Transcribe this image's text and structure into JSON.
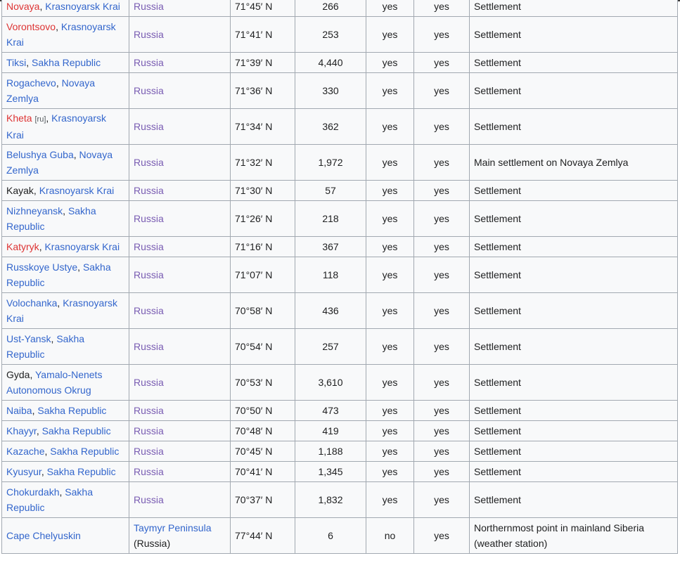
{
  "table": {
    "rows": [
      {
        "place_type": "red",
        "place": "Novaya",
        "sep": ", ",
        "region": "Krasnoyarsk Krai",
        "country": "Russia",
        "country_extra": "",
        "lat": "71°45′ N",
        "pop": "266",
        "c1": "yes",
        "c2": "yes",
        "note": "Settlement",
        "tall": false
      },
      {
        "place_type": "red",
        "place": "Vorontsovo",
        "sep": ", ",
        "region": "Krasnoyarsk Krai",
        "country": "Russia",
        "country_extra": "",
        "lat": "71°41′ N",
        "pop": "253",
        "c1": "yes",
        "c2": "yes",
        "note": "Settlement",
        "tall": true
      },
      {
        "place_type": "blue",
        "place": "Tiksi",
        "sep": ", ",
        "region": "Sakha Republic",
        "country": "Russia",
        "country_extra": "",
        "lat": "71°39′ N",
        "pop": "4,440",
        "c1": "yes",
        "c2": "yes",
        "note": "Settlement",
        "tall": false
      },
      {
        "place_type": "blue",
        "place": "Rogachevo",
        "sep": ", ",
        "region": "Novaya Zemlya",
        "country": "Russia",
        "country_extra": "",
        "lat": "71°36′ N",
        "pop": "330",
        "c1": "yes",
        "c2": "yes",
        "note": "Settlement",
        "tall": true
      },
      {
        "place_type": "red",
        "place": "Kheta",
        "tag": "[ru]",
        "sep": ", ",
        "region": "Krasnoyarsk Krai",
        "country": "Russia",
        "country_extra": "",
        "lat": "71°34′ N",
        "pop": "362",
        "c1": "yes",
        "c2": "yes",
        "note": "Settlement",
        "tall": true
      },
      {
        "place_type": "blue",
        "place": "Belushya Guba",
        "sep": ", ",
        "region": "Novaya Zemlya",
        "country": "Russia",
        "country_extra": "",
        "lat": "71°32′ N",
        "pop": "1,972",
        "c1": "yes",
        "c2": "yes",
        "note": "Main settlement on Novaya Zemlya",
        "tall": true
      },
      {
        "place_type": "plain",
        "place": "Kayak",
        "sep": ", ",
        "region": "Krasnoyarsk Krai",
        "country": "Russia",
        "country_extra": "",
        "lat": "71°30′ N",
        "pop": "57",
        "c1": "yes",
        "c2": "yes",
        "note": "Settlement",
        "tall": false
      },
      {
        "place_type": "blue",
        "place": "Nizhneyansk",
        "sep": ", ",
        "region": "Sakha Republic",
        "country": "Russia",
        "country_extra": "",
        "lat": "71°26′ N",
        "pop": "218",
        "c1": "yes",
        "c2": "yes",
        "note": "Settlement",
        "tall": true
      },
      {
        "place_type": "red",
        "place": "Katyryk",
        "sep": ", ",
        "region": "Krasnoyarsk Krai",
        "country": "Russia",
        "country_extra": "",
        "lat": "71°16′ N",
        "pop": "367",
        "c1": "yes",
        "c2": "yes",
        "note": "Settlement",
        "tall": false
      },
      {
        "place_type": "blue",
        "place": "Russkoye Ustye",
        "sep": ", ",
        "region": "Sakha Republic",
        "country": "Russia",
        "country_extra": "",
        "lat": "71°07′ N",
        "pop": "118",
        "c1": "yes",
        "c2": "yes",
        "note": "Settlement",
        "tall": true
      },
      {
        "place_type": "blue",
        "place": "Volochanka",
        "sep": ", ",
        "region": "Krasnoyarsk Krai",
        "country": "Russia",
        "country_extra": "",
        "lat": "70°58′ N",
        "pop": "436",
        "c1": "yes",
        "c2": "yes",
        "note": "Settlement",
        "tall": true
      },
      {
        "place_type": "blue",
        "place": "Ust-Yansk",
        "sep": ", ",
        "region": "Sakha Republic",
        "country": "Russia",
        "country_extra": "",
        "lat": "70°54′ N",
        "pop": "257",
        "c1": "yes",
        "c2": "yes",
        "note": "Settlement",
        "tall": true
      },
      {
        "place_type": "plain",
        "place": "Gyda",
        "sep": ", ",
        "region": "Yamalo-Nenets Autonomous Okrug",
        "country": "Russia",
        "country_extra": "",
        "lat": "70°53′ N",
        "pop": "3,610",
        "c1": "yes",
        "c2": "yes",
        "note": "Settlement",
        "tall": true
      },
      {
        "place_type": "blue",
        "place": "Naiba",
        "sep": ", ",
        "region": "Sakha Republic",
        "country": "Russia",
        "country_extra": "",
        "lat": "70°50′ N",
        "pop": "473",
        "c1": "yes",
        "c2": "yes",
        "note": "Settlement",
        "tall": false
      },
      {
        "place_type": "blue",
        "place": "Khayyr",
        "sep": ", ",
        "region": "Sakha Republic",
        "country": "Russia",
        "country_extra": "",
        "lat": "70°48′ N",
        "pop": "419",
        "c1": "yes",
        "c2": "yes",
        "note": "Settlement",
        "tall": false
      },
      {
        "place_type": "blue",
        "place": "Kazache",
        "sep": ", ",
        "region": "Sakha Republic",
        "country": "Russia",
        "country_extra": "",
        "lat": "70°45′ N",
        "pop": "1,188",
        "c1": "yes",
        "c2": "yes",
        "note": "Settlement",
        "tall": false
      },
      {
        "place_type": "blue",
        "place": "Kyusyur",
        "sep": ", ",
        "region": "Sakha Republic",
        "country": "Russia",
        "country_extra": "",
        "lat": "70°41′ N",
        "pop": "1,345",
        "c1": "yes",
        "c2": "yes",
        "note": "Settlement",
        "tall": false
      },
      {
        "place_type": "blue",
        "place": "Chokurdakh",
        "sep": ", ",
        "region": "Sakha Republic",
        "country": "Russia",
        "country_extra": "",
        "lat": "70°37′ N",
        "pop": "1,832",
        "c1": "yes",
        "c2": "yes",
        "note": "Settlement",
        "tall": true
      },
      {
        "place_type": "blue",
        "place": "Cape Chelyuskin",
        "sep": "",
        "region": "",
        "country": "Taymyr Peninsula",
        "country_extra": "(Russia)",
        "lat": "77°44′ N",
        "pop": "6",
        "c1": "no",
        "c2": "yes",
        "note": "Northernmost point in mainland Siberia (weather station)",
        "tall": true
      }
    ]
  }
}
